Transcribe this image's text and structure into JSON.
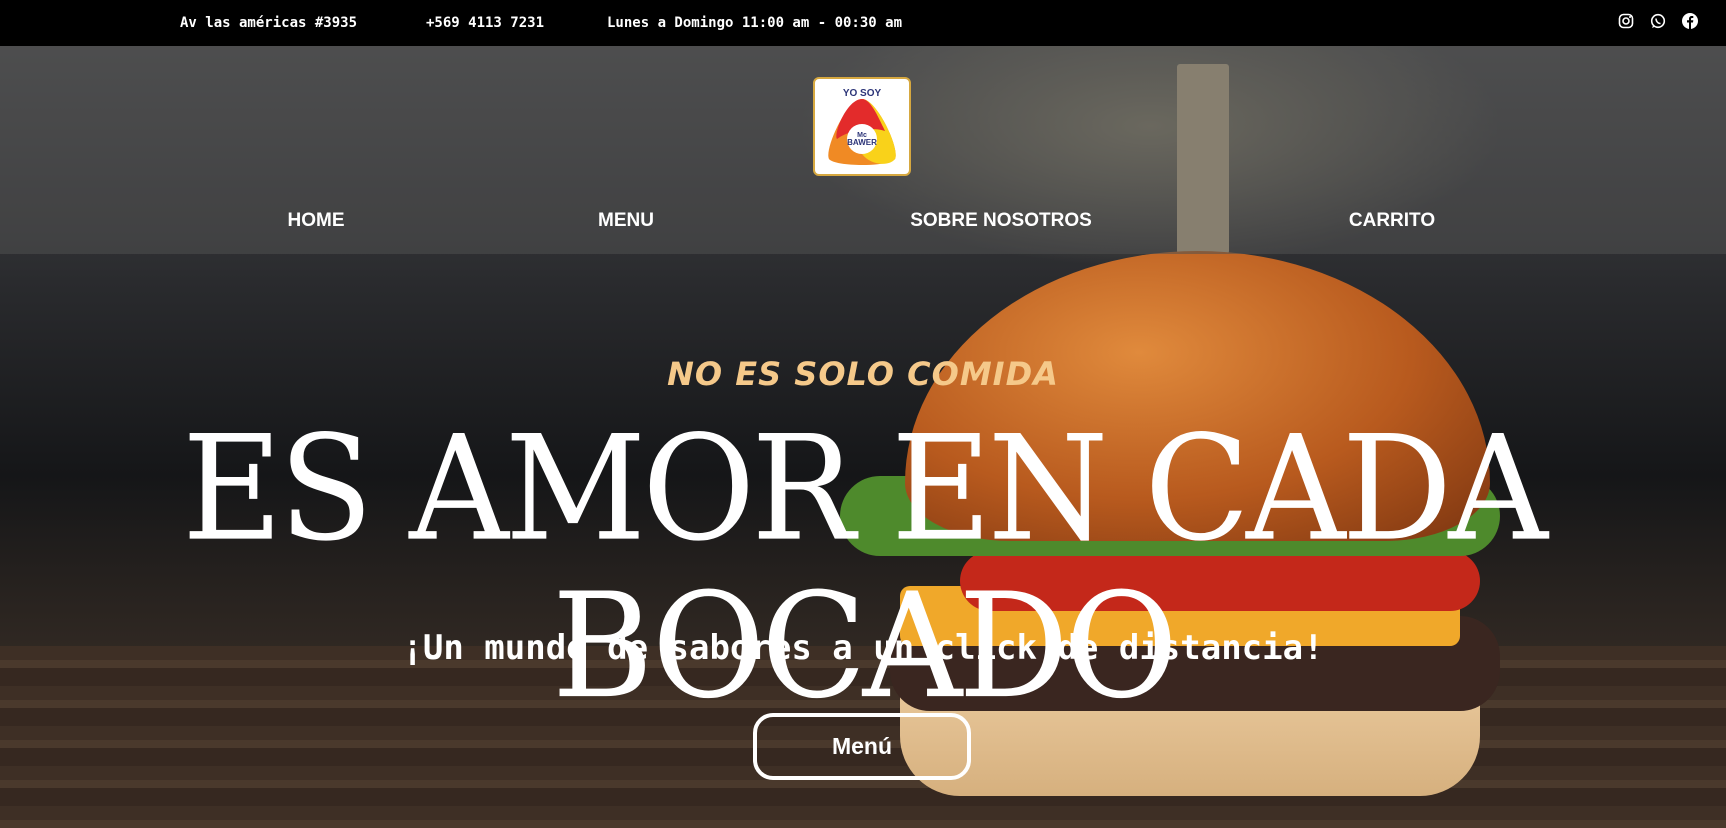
{
  "topbar": {
    "address": "Av las américas #3935",
    "phone": "+569 4113 7231",
    "hours": "Lunes a Domingo 11:00 am - 00:30 am",
    "social": [
      "instagram-icon",
      "whatsapp-icon",
      "facebook-icon"
    ]
  },
  "logo": {
    "line1": "YO SOY",
    "line2": "Mc",
    "line3": "BAWER"
  },
  "nav": {
    "items": [
      {
        "label": "HOME"
      },
      {
        "label": "MENU"
      },
      {
        "label": "SOBRE NOSOTROS"
      },
      {
        "label": "CARRITO"
      }
    ]
  },
  "hero": {
    "tagline": "NO ES SOLO COMIDA",
    "headline": "ES AMOR EN CADA BOCADO",
    "subtitle": "¡Un mundo de sabores a un click de distancia!",
    "button": "Menú"
  },
  "colors": {
    "tagline": "#f5c98a",
    "topbar": "#000000",
    "logo_red": "#e32b2b",
    "logo_orange": "#f08a24",
    "logo_yellow": "#f9d21a",
    "logo_text": "#2c3478"
  }
}
